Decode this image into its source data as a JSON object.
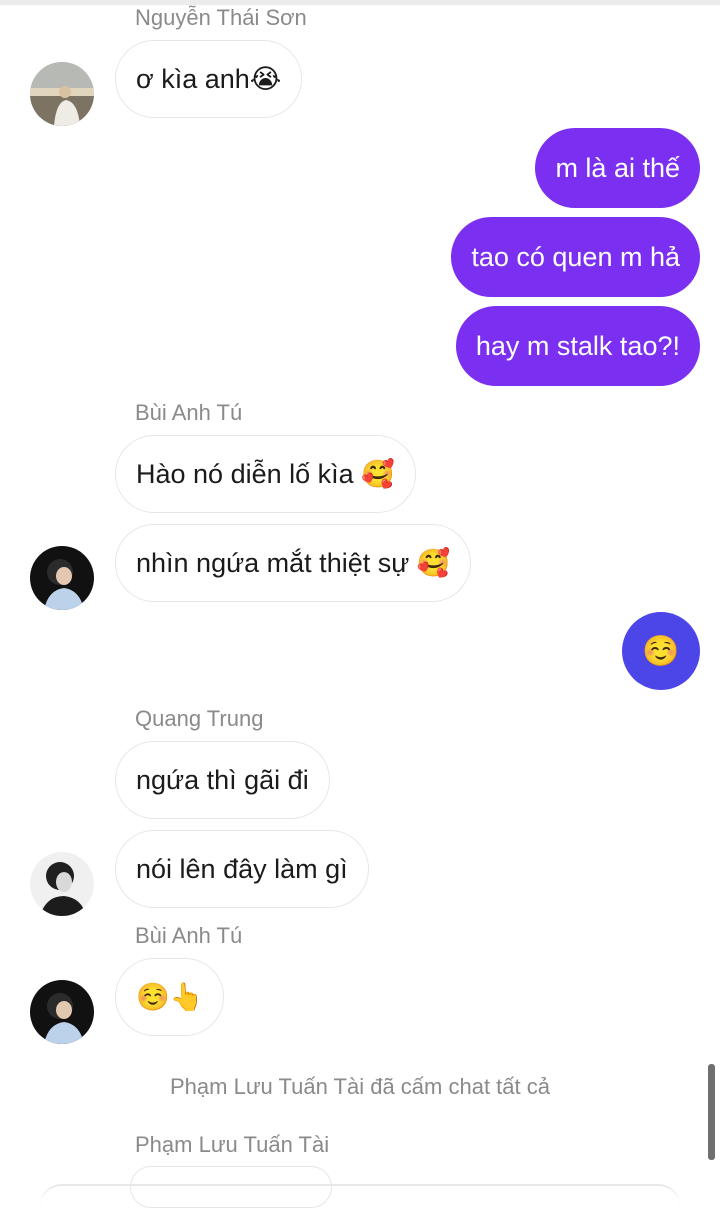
{
  "messages": [
    {
      "sender": "Nguyễn Thái Sơn",
      "text": "ơ kìa anh😭"
    },
    {
      "text": "m là ai thế"
    },
    {
      "text": "tao có quen m hả"
    },
    {
      "text": "hay m stalk tao?!"
    },
    {
      "sender": "Bùi Anh Tú",
      "text": "Hào nó diễn lố kìa 🥰"
    },
    {
      "text": "nhìn ngứa mắt thiệt sự 🥰"
    },
    {
      "text": "☺️"
    },
    {
      "sender": "Quang Trung",
      "text": "ngứa thì gãi đi"
    },
    {
      "text": "nói lên đây làm gì"
    },
    {
      "sender": "Bùi Anh Tú",
      "text": "☺️👆"
    }
  ],
  "system": {
    "note": "Phạm Lưu Tuấn Tài đã cấm chat tất cả"
  },
  "last_sender": "Phạm Lưu Tuấn Tài",
  "colors": {
    "outgoing": "#7b2ff0",
    "emoji_circle": "#4c45e8",
    "sender_text": "#8a8a8a"
  }
}
